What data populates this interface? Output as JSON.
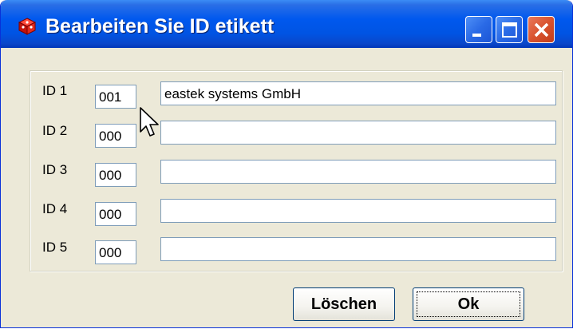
{
  "window": {
    "title": "Bearbeiten Sie ID etikett",
    "icon": "app-cube-icon",
    "controls": [
      "minimize-icon",
      "maximize-icon",
      "close-icon"
    ]
  },
  "rows": [
    {
      "label": "ID 1",
      "code": "001",
      "name": "eastek systems GmbH"
    },
    {
      "label": "ID 2",
      "code": "000",
      "name": ""
    },
    {
      "label": "ID 3",
      "code": "000",
      "name": ""
    },
    {
      "label": "ID 4",
      "code": "000",
      "name": ""
    },
    {
      "label": "ID 5",
      "code": "000",
      "name": ""
    }
  ],
  "buttons": {
    "delete_label": "Löschen",
    "ok_label": "Ok"
  },
  "colors": {
    "titlebar": "#0054e3",
    "close_button": "#d9532f",
    "dialog_bg": "#ece9d8"
  }
}
